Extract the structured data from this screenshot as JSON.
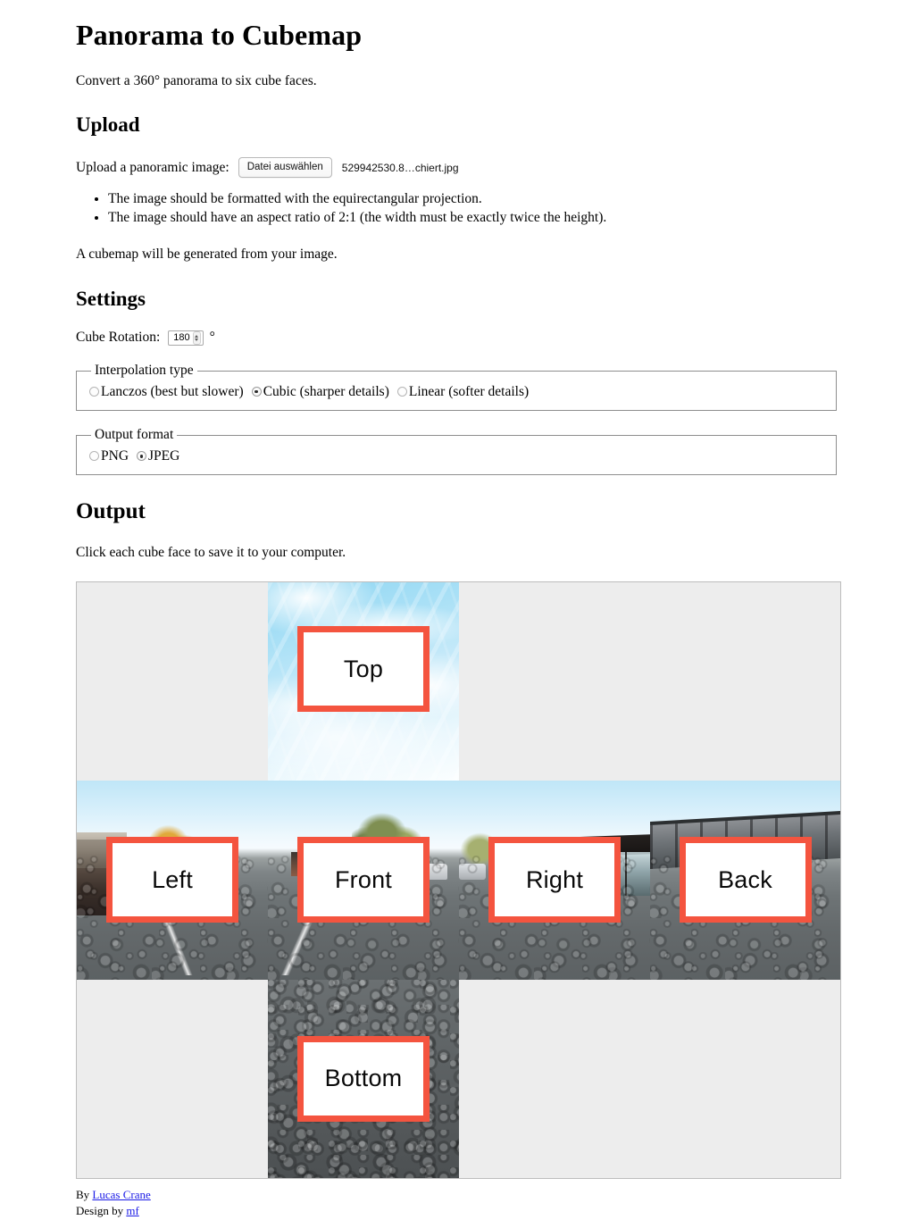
{
  "page": {
    "title": "Panorama to Cubemap",
    "intro": "Convert a 360° panorama to six cube faces."
  },
  "upload": {
    "heading": "Upload",
    "label": "Upload a panoramic image:",
    "button_label": "Datei auswählen",
    "file_name": "529942530.8…chiert.jpg",
    "notes": [
      "The image should be formatted with the equirectangular projection.",
      "The image should have an aspect ratio of 2:1 (the width must be exactly twice the height)."
    ],
    "result_note": "A cubemap will be generated from your image."
  },
  "settings": {
    "heading": "Settings",
    "rotation_label": "Cube Rotation:",
    "rotation_value": "180",
    "rotation_unit": "°",
    "interpolation": {
      "legend": "Interpolation type",
      "options": [
        {
          "label": "Lanczos (best but slower)",
          "selected": false
        },
        {
          "label": "Cubic (sharper details)",
          "selected": true
        },
        {
          "label": "Linear (softer details)",
          "selected": false
        }
      ]
    },
    "format": {
      "legend": "Output format",
      "options": [
        {
          "label": "PNG",
          "selected": false
        },
        {
          "label": "JPEG",
          "selected": true
        }
      ]
    }
  },
  "output": {
    "heading": "Output",
    "instruction": "Click each cube face to save it to your computer.",
    "faces": {
      "top": "Top",
      "left": "Left",
      "front": "Front",
      "right": "Right",
      "back": "Back",
      "bottom": "Bottom"
    }
  },
  "footer": {
    "by_prefix": "By ",
    "author_link": "Lucas Crane",
    "design_prefix": "Design by ",
    "design_link": "mf"
  },
  "colors": {
    "label_border": "#f4543f",
    "link": "#1a1ae6",
    "panel_background": "#ededed",
    "panel_border": "#bdbdbd"
  }
}
